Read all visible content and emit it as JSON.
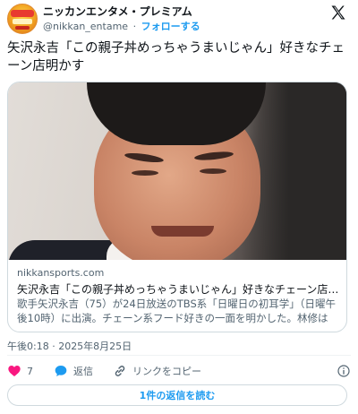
{
  "account": {
    "display_name": "ニッカンエンタメ・プレミアム",
    "handle": "@nikkan_entame",
    "separator": "·",
    "follow_label": "フォローする"
  },
  "tweet": {
    "text": "矢沢永吉「この親子丼めっちゃうまいじゃん」好きなチェーン店明かす"
  },
  "link_card": {
    "domain": "nikkansports.com",
    "title": "矢沢永吉「この親子丼めっちゃうまいじゃん」好きなチェーン店明か…",
    "description": "歌手矢沢永吉（75）が24日放送のTBS系「日曜日の初耳学」（日曜午後10時）に出演。チェーン系フード好きの一面を明かした。林修は「チェ…"
  },
  "meta": {
    "timestamp": "午後0:18 · 2025年8月25日"
  },
  "actions": {
    "like_count": "7",
    "reply_label": "返信",
    "copy_link_label": "リンクをコピー"
  },
  "replies_button": {
    "label": "1件の返信を読む"
  },
  "icons": {
    "like": "heart-icon",
    "reply": "speech-bubble-icon",
    "copy": "link-icon",
    "info": "info-icon",
    "brand": "x-logo-icon"
  },
  "colors": {
    "accent": "#1d9bf0",
    "like": "#f91880",
    "text": "#0f1419",
    "muted": "#536471",
    "border": "#cfd9de"
  }
}
